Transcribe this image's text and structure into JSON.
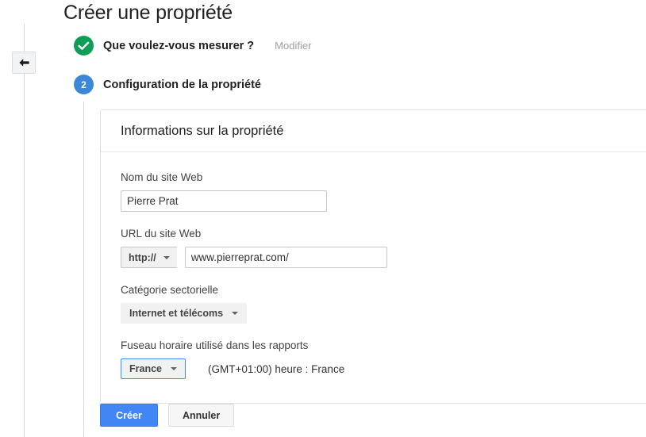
{
  "page": {
    "title": "Créer une propriété"
  },
  "nav": {
    "back_icon": "arrow-left-icon"
  },
  "steps": [
    {
      "id": "step-1",
      "state": "done",
      "marker": "check-icon",
      "label": "Que voulez-vous mesurer ?",
      "action_label": "Modifier"
    },
    {
      "id": "step-2",
      "state": "current",
      "marker": "2",
      "label": "Configuration de la propriété",
      "action_label": ""
    }
  ],
  "card": {
    "header_title": "Informations sur la propriété",
    "fields": {
      "site_name": {
        "label": "Nom du site Web",
        "value": "Pierre Prat",
        "placeholder": ""
      },
      "site_url": {
        "label": "URL du site Web",
        "protocol": "http://",
        "value": "www.pierreprat.com/",
        "placeholder": ""
      },
      "industry": {
        "label": "Catégorie sectorielle",
        "value": "Internet et télécoms"
      },
      "timezone": {
        "label": "Fuseau horaire utilisé dans les rapports",
        "value": "France",
        "note": "(GMT+01:00) heure : France"
      }
    }
  },
  "actions": {
    "submit_label": "Créer",
    "cancel_label": "Annuler"
  },
  "colors": {
    "accent_blue": "#4285f4",
    "step_blue": "#3d87d9",
    "success_green": "#0f9d58",
    "muted_text": "#9e9e9e",
    "border": "#e0e0e0"
  }
}
